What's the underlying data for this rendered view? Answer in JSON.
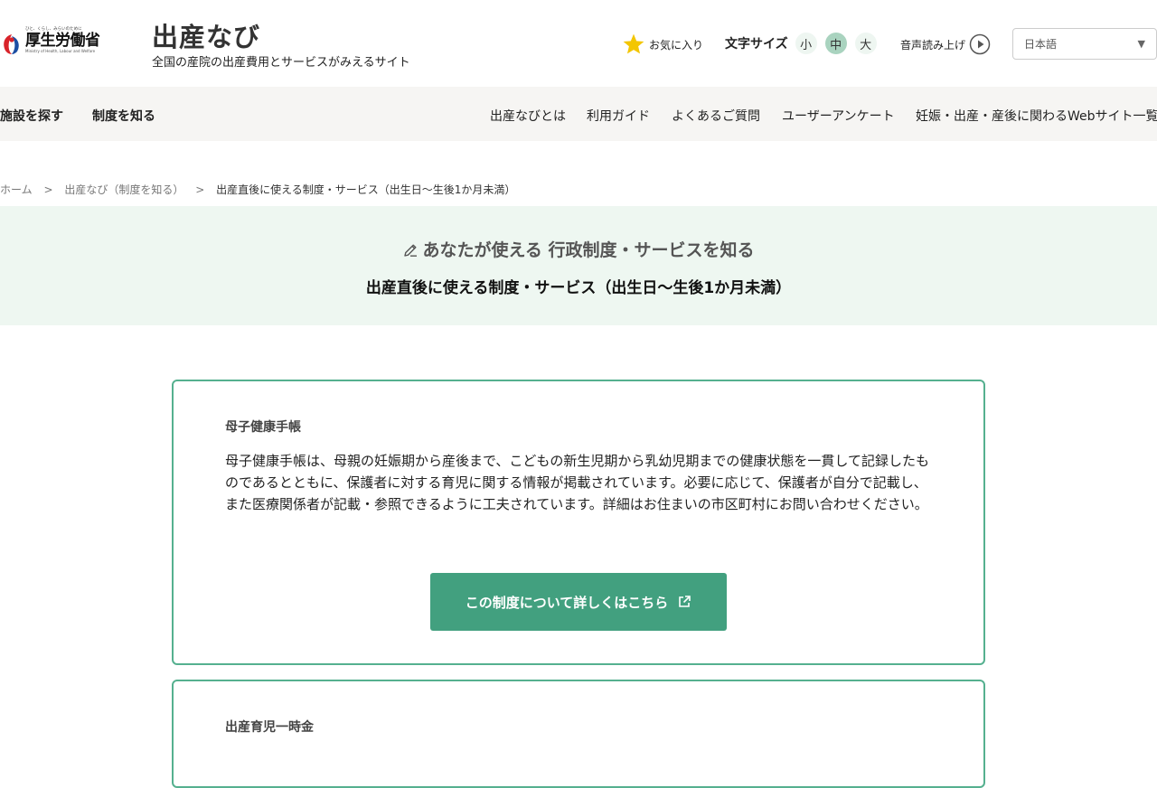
{
  "header": {
    "logo": {
      "slogan": "ひと、くらし、みらいのために",
      "name": "厚生労働省",
      "english": "Ministry of Health, Labour and Welfare"
    },
    "site_title": "出産なび",
    "tagline": "全国の産院の出産費用とサービスがみえるサイト",
    "favorites_label": "お気に入り",
    "font_size": {
      "label": "文字サイズ",
      "options": [
        "小",
        "中",
        "大"
      ],
      "selected": "中"
    },
    "tts_label": "音声読み上げ",
    "language": {
      "selected": "日本語"
    }
  },
  "nav": {
    "left": [
      "施設を探す",
      "制度を知る"
    ],
    "right": [
      "出産なびとは",
      "利用ガイド",
      "よくあるご質問",
      "ユーザーアンケート",
      "妊娠・出産・産後に関わるWebサイト一覧"
    ]
  },
  "breadcrumb": {
    "items": [
      "ホーム",
      "出産なび（制度を知る）",
      "出産直後に使える制度・サービス（出生日〜生後1か月未満）"
    ],
    "separator": ">"
  },
  "hero": {
    "subtitle": "あなたが使える 行政制度・サービスを知る",
    "title": "出産直後に使える制度・サービス（出生日〜生後1か月未満）"
  },
  "cards": [
    {
      "title": "母子健康手帳",
      "body": "母子健康手帳は、母親の妊娠期から産後まで、こどもの新生児期から乳幼児期までの健康状態を一貫して記録したものであるとともに、保護者に対する育児に関する情報が掲載されています。必要に応じて、保護者が自分で記載し、また医療関係者が記載・参照できるように工夫されています。詳細はお住まいの市区町村にお問い合わせください。",
      "button_label": "この制度について詳しくはこちら"
    },
    {
      "title": "出産育児一時金"
    }
  ],
  "colors": {
    "accent": "#42a07f",
    "card_border": "#55b08f",
    "hero_bg": "#eef7f1",
    "nav_bg": "#f6f5f3",
    "star": "#f3c600"
  }
}
